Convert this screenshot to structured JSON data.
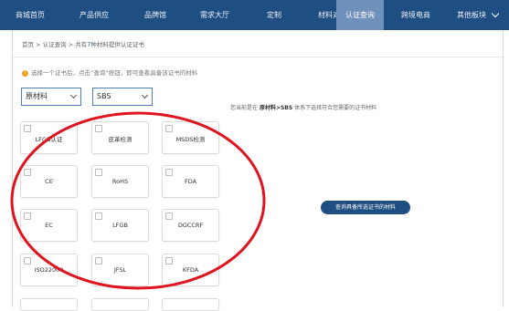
{
  "nav": {
    "items": [
      {
        "label": "商城首页"
      },
      {
        "label": "产品供应"
      },
      {
        "label": "品牌馆"
      },
      {
        "label": "需求大厅"
      },
      {
        "label": "定制"
      },
      {
        "label": "材料对比"
      },
      {
        "label": "认证查询"
      },
      {
        "label": "跨境电商"
      },
      {
        "label": "其他板块"
      }
    ],
    "active_index": 6
  },
  "breadcrumb": {
    "home": "首页",
    "sep1": ">",
    "section": "认证查询",
    "sep2": ">",
    "prefix": "共有",
    "count": "7",
    "suffix": "种材料提供认证证书"
  },
  "hint": {
    "icon": "!",
    "text": "选择一个证书后，点击“查询”按钮，即可查看具备该证书的材料"
  },
  "selects": {
    "category": "原材料",
    "material": "SBS"
  },
  "current": {
    "prefix": "您当前是在",
    "path": "原材料>SBS",
    "suffix": "体系下选择符合您需要的证书材料"
  },
  "certificates": [
    {
      "label": "LFGB认证"
    },
    {
      "label": "皮革检测"
    },
    {
      "label": "MSDS检测"
    },
    {
      "label": "CE"
    },
    {
      "label": "RoHS"
    },
    {
      "label": "FDA"
    },
    {
      "label": "EC"
    },
    {
      "label": "LFGB"
    },
    {
      "label": "DGCCRF"
    },
    {
      "label": "ISO22000"
    },
    {
      "label": "JFSL"
    },
    {
      "label": "KFDA"
    }
  ],
  "query_button": "查询具备所选证书的材料",
  "colors": {
    "nav_bg": "#1f4e82",
    "nav_active": "#6f90b8",
    "annotation": "#e0141e",
    "hint_icon": "#f29e1f"
  }
}
